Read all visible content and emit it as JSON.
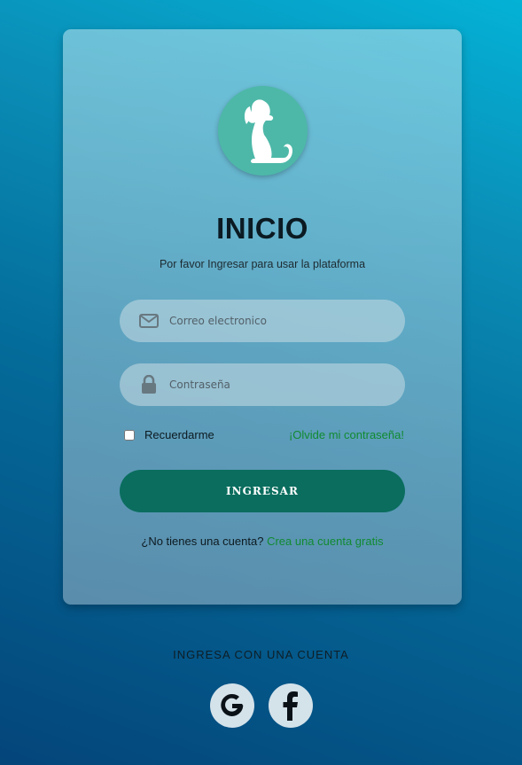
{
  "login": {
    "title": "INICIO",
    "subtitle": "Por favor Ingresar para usar la plataforma",
    "email_placeholder": "Correo electronico",
    "password_placeholder": "Contraseña",
    "remember_label": "Recuerdarme",
    "forgot_link": "¡Olvide mi contraseña!",
    "submit_label": "INGRESAR",
    "no_account_text": "¿No tienes una cuenta?",
    "signup_link": "Crea una cuenta gratis"
  },
  "social": {
    "heading": "INGRESA CON UNA CUENTA",
    "providers": [
      {
        "icon": "google-icon"
      },
      {
        "icon": "facebook-icon"
      }
    ]
  },
  "colors": {
    "accent": "#0a6d5e",
    "logo_bg": "#4db8a8",
    "link": "#118a30"
  },
  "logo": {
    "icon": "dog-icon"
  }
}
